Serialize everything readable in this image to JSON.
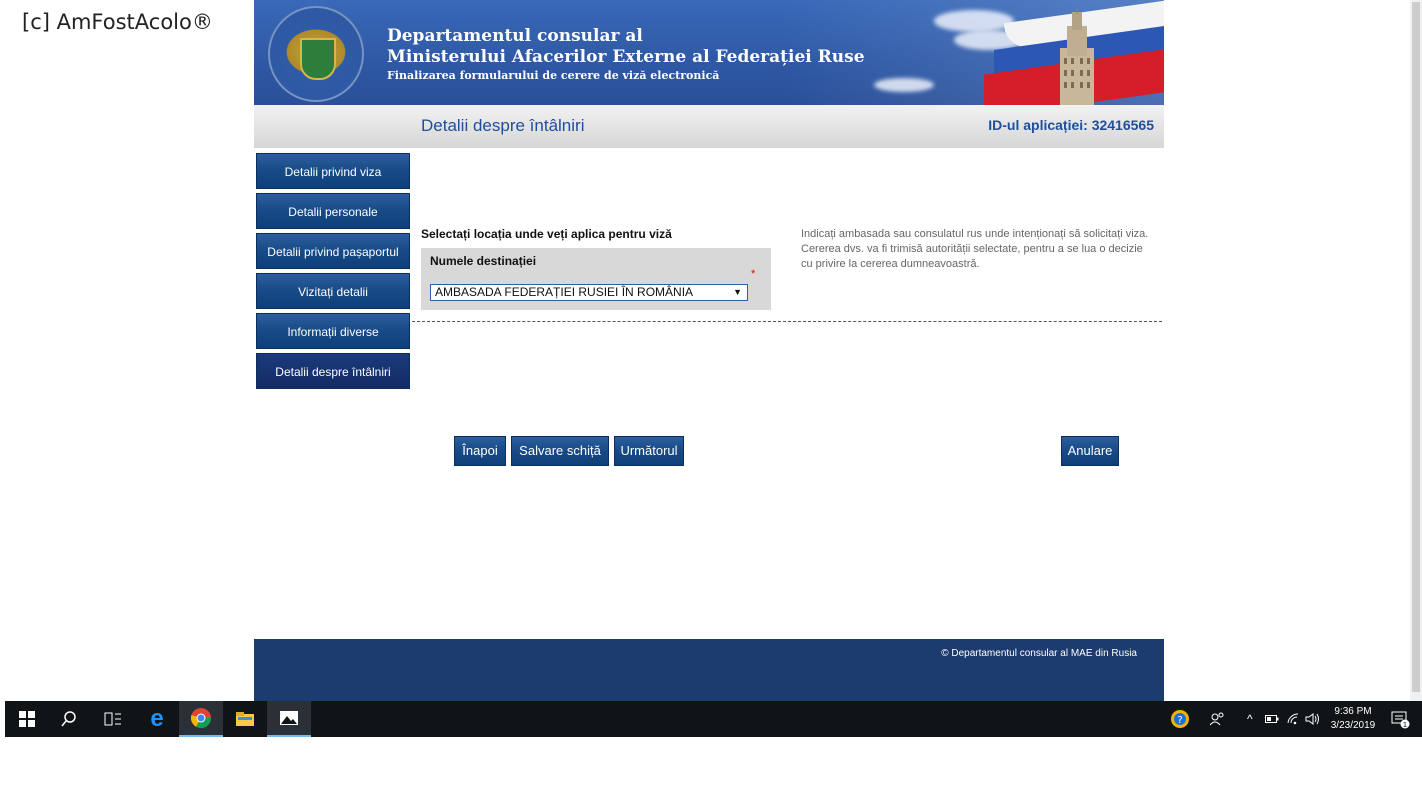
{
  "watermark": "[c] AmFostAcolo®",
  "header": {
    "line1": "Departamentul consular al",
    "line2": "Ministerului Afacerilor Externe al Federației Ruse",
    "line3": "Finalizarea formularului de cerere de viză electronică"
  },
  "subheader": {
    "title": "Detalii despre întâlniri",
    "app_id": "ID-ul aplicației: 32416565"
  },
  "sidebar": {
    "items": [
      {
        "label": "Detalii privind viza"
      },
      {
        "label": "Detalii personale"
      },
      {
        "label": "Detalii privind pașaportul"
      },
      {
        "label": "Vizitați detalii"
      },
      {
        "label": "Informații diverse"
      },
      {
        "label": "Detalii despre întâlniri",
        "active": true
      }
    ]
  },
  "form": {
    "section_label": "Selectați locația unde veți aplica pentru viză",
    "field_label": "Numele destinației",
    "required_mark": "*",
    "destination_value": "AMBASADA FEDERAȚIEI RUSIEI ÎN ROMÂNIA",
    "help_text": "Indicați ambasada sau consulatul rus unde intenționați să solicitați viza. Cererea dvs. va fi trimisă autorității selectate, pentru a se lua o decizie cu privire la cererea dumneavoastră."
  },
  "buttons": {
    "back": "Înapoi",
    "save_draft": "Salvare schiță",
    "next": "Următorul",
    "cancel": "Anulare"
  },
  "footer": {
    "copyright": "© Departamentul consular al MAE din Rusia"
  },
  "taskbar": {
    "time": "9:36 PM",
    "date": "3/23/2019",
    "notification_count": "1"
  },
  "colors": {
    "banner": "#2f5aa6",
    "button": "#174a86",
    "title_text": "#1f4e9b",
    "footer": "#1c3b6e"
  }
}
